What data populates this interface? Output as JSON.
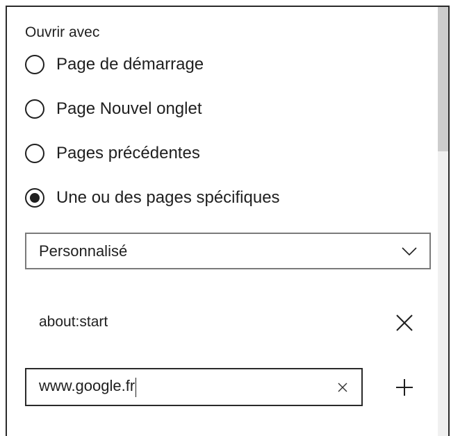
{
  "section": {
    "title": "Ouvrir avec"
  },
  "options": [
    {
      "label": "Page de démarrage",
      "checked": false
    },
    {
      "label": "Page Nouvel onglet",
      "checked": false
    },
    {
      "label": "Pages précédentes",
      "checked": false
    },
    {
      "label": "Une ou des pages spécifiques",
      "checked": true
    }
  ],
  "dropdown": {
    "selected": "Personnalisé",
    "icon": "chevron-down-icon"
  },
  "pages": [
    {
      "url": "about:start",
      "remove_icon": "close-icon"
    }
  ],
  "new_page": {
    "value": "www.google.fr",
    "clear_icon": "clear-icon",
    "add_icon": "plus-icon"
  },
  "colors": {
    "text": "#1f1f1f",
    "border": "#2a2a2a",
    "scroll_thumb": "#cdcdcd",
    "scroll_track": "#f0f0f0"
  }
}
